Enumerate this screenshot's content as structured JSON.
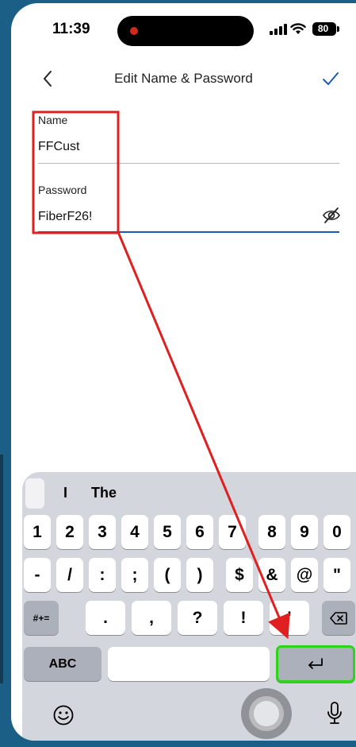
{
  "status_bar": {
    "time": "11:39",
    "battery": "80"
  },
  "nav": {
    "title": "Edit Name & Password",
    "back_icon": "chevron-left-icon",
    "done_icon": "checkmark-icon"
  },
  "form": {
    "name_label": "Name",
    "name_value": "FFCust",
    "password_label": "Password",
    "password_value": "FiberF26!",
    "eye_icon": "eye-slash-icon"
  },
  "keyboard": {
    "suggestions": [
      "I",
      "The"
    ],
    "row1": [
      "1",
      "2",
      "3",
      "4",
      "5",
      "6",
      "7",
      "8",
      "9",
      "0"
    ],
    "row2": [
      "-",
      "/",
      ":",
      ";",
      "(",
      ")",
      "$",
      "&",
      "@",
      "\""
    ],
    "row3_left": "#+=",
    "row3": [
      ".",
      ",",
      "?",
      "!",
      "'"
    ],
    "abc": "ABC",
    "delete_icon": "backspace-icon",
    "return_icon": "return-icon",
    "emoji_icon": "emoji-icon",
    "mic_icon": "microphone-icon"
  },
  "colors": {
    "accent": "#1a5bb5",
    "highlight_red": "#e02020",
    "highlight_green": "#2ed41a"
  }
}
